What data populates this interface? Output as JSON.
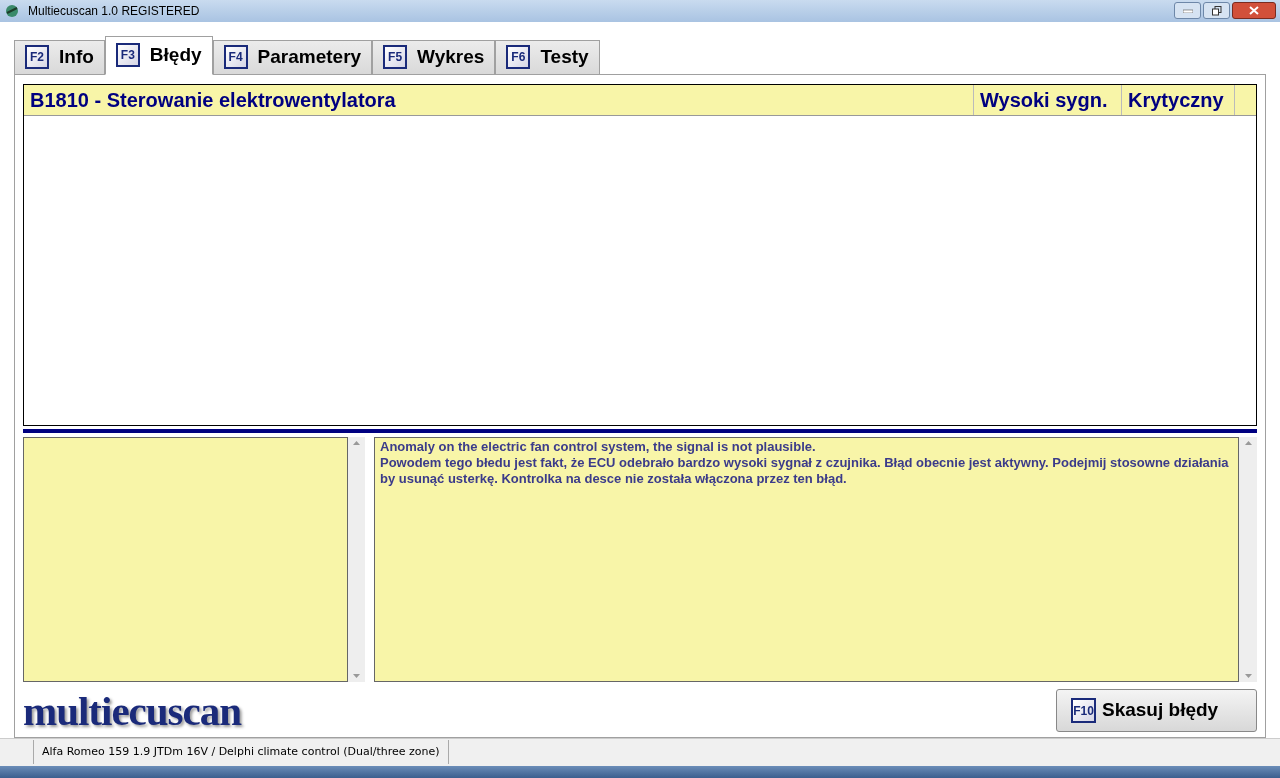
{
  "window": {
    "title": "Multiecuscan 1.0 REGISTERED"
  },
  "tabs": [
    {
      "key": "F2",
      "label": "Info",
      "selected": false
    },
    {
      "key": "F3",
      "label": "Błędy",
      "selected": true
    },
    {
      "key": "F4",
      "label": "Parametery",
      "selected": false
    },
    {
      "key": "F5",
      "label": "Wykres",
      "selected": false
    },
    {
      "key": "F6",
      "label": "Testy",
      "selected": false
    }
  ],
  "faults": {
    "columns": [
      "B1810 - Sterowanie elektrowentylatora",
      "Wysoki sygn.",
      "Krytyczny"
    ]
  },
  "description": {
    "lines": [
      "Anomaly on the electric fan control system, the signal is not plausible.",
      "Powodem tego błedu jest fakt, że ECU odebrało bardzo wysoki sygnał z czujnika. Błąd obecnie jest aktywny. Podejmij stosowne działania by usunąć usterkę. Kontrolka na desce nie została włączona przez ten błąd."
    ]
  },
  "logo": "multiecuscan",
  "clear_button": {
    "key": "F10",
    "label": "Skasuj błędy"
  },
  "status_bar": "Alfa Romeo 159 1.9 JTDm 16V / Delphi climate control (Dual/three zone)"
}
